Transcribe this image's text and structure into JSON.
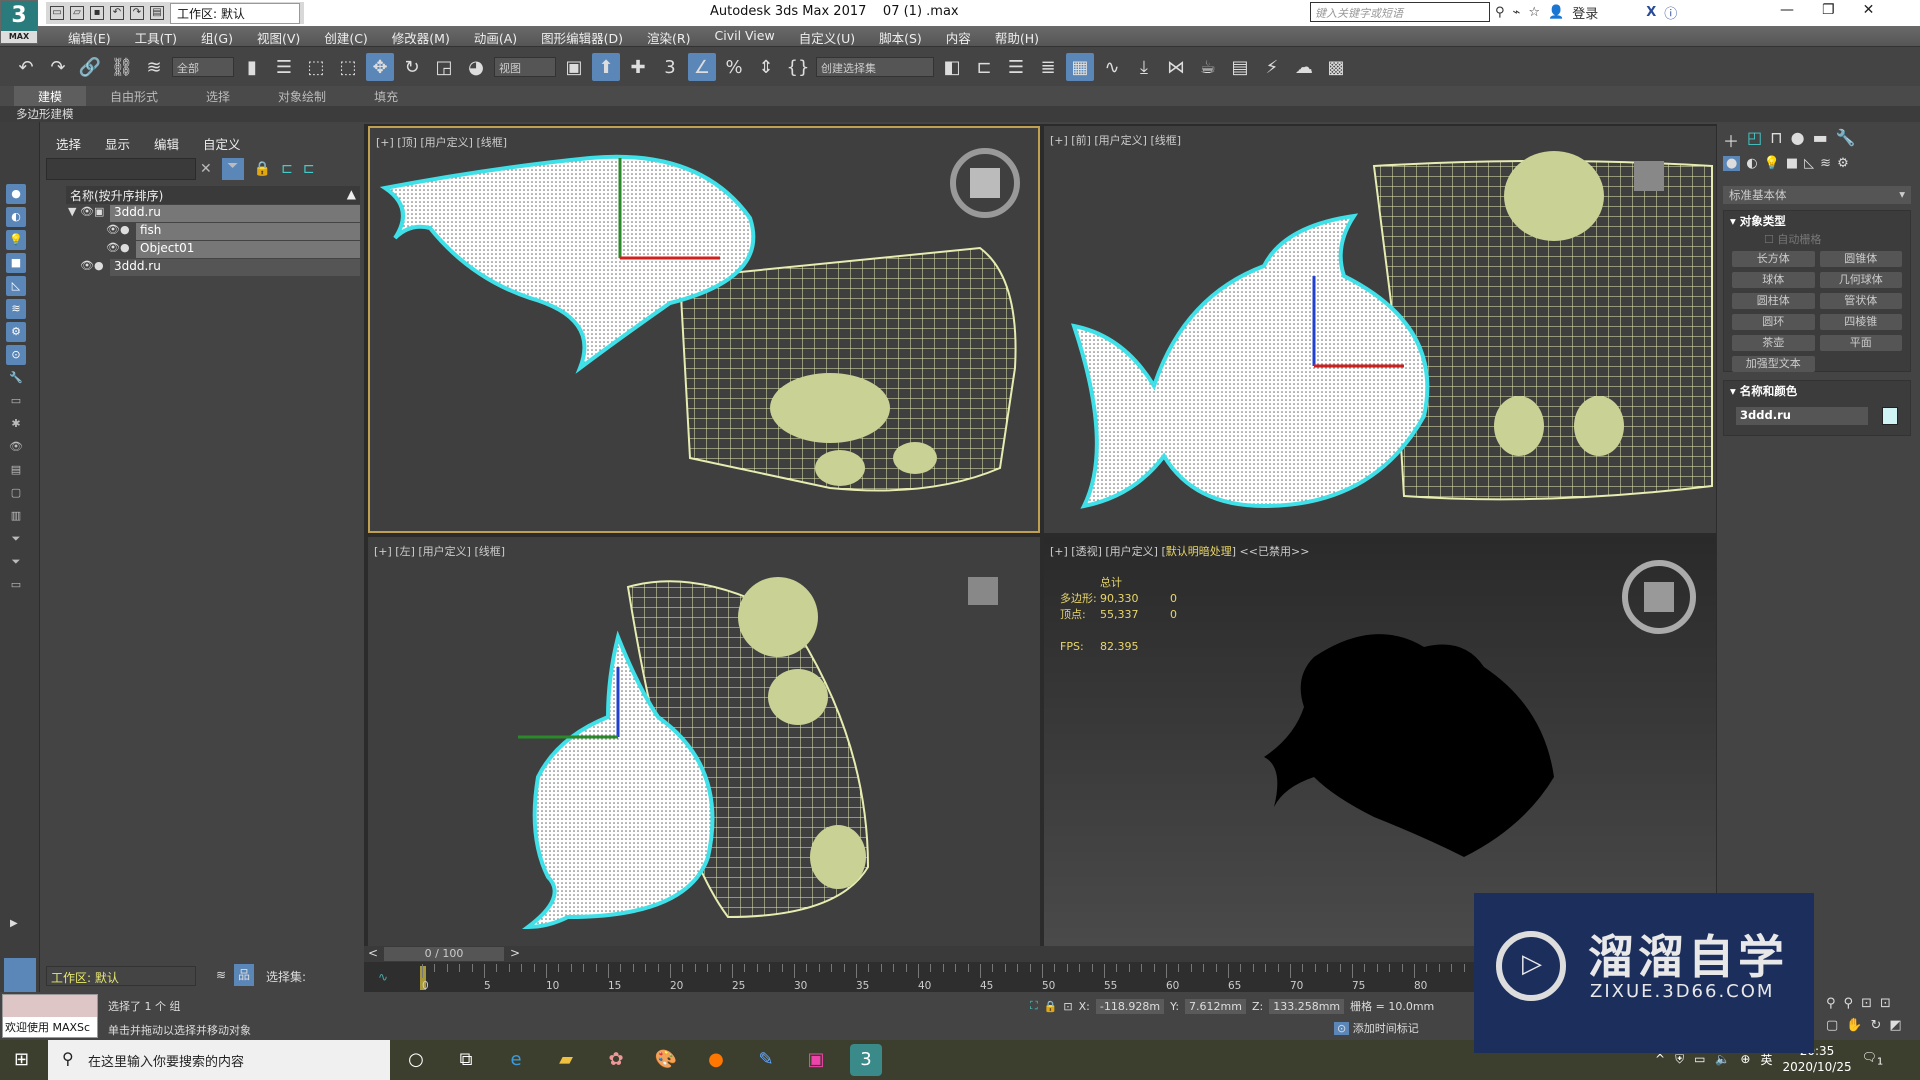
{
  "titlebar": {
    "app_title": "Autodesk 3ds Max 2017",
    "file": "07  (1)  .max",
    "workspace": "工作区: 默认",
    "search_placeholder": "键入关键字或短语",
    "login": "登录",
    "logo_text": "3",
    "logo_sub": "MAX"
  },
  "menus": [
    "编辑(E)",
    "工具(T)",
    "组(G)",
    "视图(V)",
    "创建(C)",
    "修改器(M)",
    "动画(A)",
    "图形编辑器(D)",
    "渲染(R)",
    "Civil View",
    "自定义(U)",
    "脚本(S)",
    "内容",
    "帮助(H)"
  ],
  "toolbar": {
    "filter": "全部",
    "ref_coord": "视图",
    "selection_set": "创建选择集",
    "icons": [
      "undo-icon",
      "redo-icon",
      "link-icon",
      "unlink-icon",
      "bind-space-warp-icon",
      "select-object-icon",
      "select-by-name-icon",
      "rect-selection-icon",
      "window-crossing-icon",
      "move-icon",
      "rotate-icon",
      "scale-icon",
      "place-icon",
      "pivot-icon",
      "select-manipulate-icon",
      "keyboard-shortcut-icon",
      "snap-3d-icon",
      "angle-snap-icon",
      "percent-snap-icon",
      "spinner-snap-icon",
      "edit-named-sets-icon",
      "mirror-icon",
      "align-icon",
      "scene-explorer-toggle-icon",
      "layer-explorer-icon",
      "ribbon-toggle-icon",
      "curve-editor-icon",
      "dope-sheet-icon",
      "schematic-view-icon",
      "render-setup-icon",
      "rendered-frame-window-icon",
      "render-icon",
      "render-cloud-icon",
      "material-editor-icon"
    ],
    "active_icons": [
      "move-icon",
      "select-manipulate-icon",
      "angle-snap-icon",
      "ribbon-toggle-icon"
    ]
  },
  "ribbon": {
    "tabs": [
      "建模",
      "自由形式",
      "选择",
      "对象绘制",
      "填充"
    ],
    "active": 0,
    "subtitle": "多边形建模"
  },
  "explorer": {
    "menu": [
      "选择",
      "显示",
      "编辑",
      "自定义"
    ],
    "column_header": "名称(按升序排序)",
    "rows": [
      {
        "name": "3ddd.ru",
        "level": 0,
        "expanded": true
      },
      {
        "name": "fish",
        "level": 1
      },
      {
        "name": "Object01",
        "level": 1
      },
      {
        "name": "3ddd.ru",
        "level": 0
      }
    ],
    "workspace": "工作区: 默认",
    "selection_set_label": "选择集:"
  },
  "viewports": {
    "top": {
      "label": "[+] [顶] [用户定义] [线框]"
    },
    "front": {
      "label": "[+] [前] [用户定义] [线框]"
    },
    "left": {
      "label": "[+] [左] [用户定义] [线框]"
    },
    "perspective": {
      "label_a": "[+] [透视] [用户定义] [",
      "label_b": "默认明暗处理",
      "label_c": "] <<已禁用>>",
      "stats": {
        "total": "总计",
        "poly_label": "多边形:",
        "poly": "90,330",
        "poly_sel": "0",
        "vert_label": "顶点:",
        "vert": "55,337",
        "vert_sel": "0",
        "fps_label": "FPS:",
        "fps": "82.395"
      }
    }
  },
  "command_panel": {
    "dropdown": "标准基本体",
    "object_type_title": "对象类型",
    "autogrid": "自动栅格",
    "buttons": [
      "长方体",
      "圆锥体",
      "球体",
      "几何球体",
      "圆柱体",
      "管状体",
      "圆环",
      "四棱锥",
      "茶壶",
      "平面",
      "加强型文本"
    ],
    "name_color_title": "名称和颜色",
    "object_name": "3ddd.ru",
    "object_color": "#d0f4f6"
  },
  "timeline": {
    "position": "0 / 100",
    "ticks": [
      "0",
      "5",
      "10",
      "15",
      "20",
      "25",
      "30",
      "35",
      "40",
      "45",
      "50",
      "55",
      "60",
      "65",
      "70",
      "75",
      "80"
    ]
  },
  "status": {
    "maxscript_prompt": "欢迎使用 MAXSc",
    "selected": "选择了 1 个 组",
    "hint": "单击并拖动以选择并移动对象",
    "x": "-118.928m",
    "y": "7.612mm",
    "z": "133.258mm",
    "grid": "栅格 = 10.0mm",
    "add_time_tag": "添加时间标记",
    "x_label": "X:",
    "y_label": "Y:",
    "z_label": "Z:"
  },
  "taskbar": {
    "search": "在这里输入你要搜索的内容",
    "time": "20:35",
    "date": "2020/10/25",
    "ime": "英",
    "notification_count": "1"
  },
  "watermark": {
    "title": "溜溜自学",
    "url": "ZIXUE.3D66.COM"
  },
  "colors": {
    "accent": "#5b86b8",
    "active_viewport": "#c0a050",
    "wire": "#e7ecb0",
    "selection_outline": "#40e0e8",
    "stats_text": "#e8d66a"
  }
}
